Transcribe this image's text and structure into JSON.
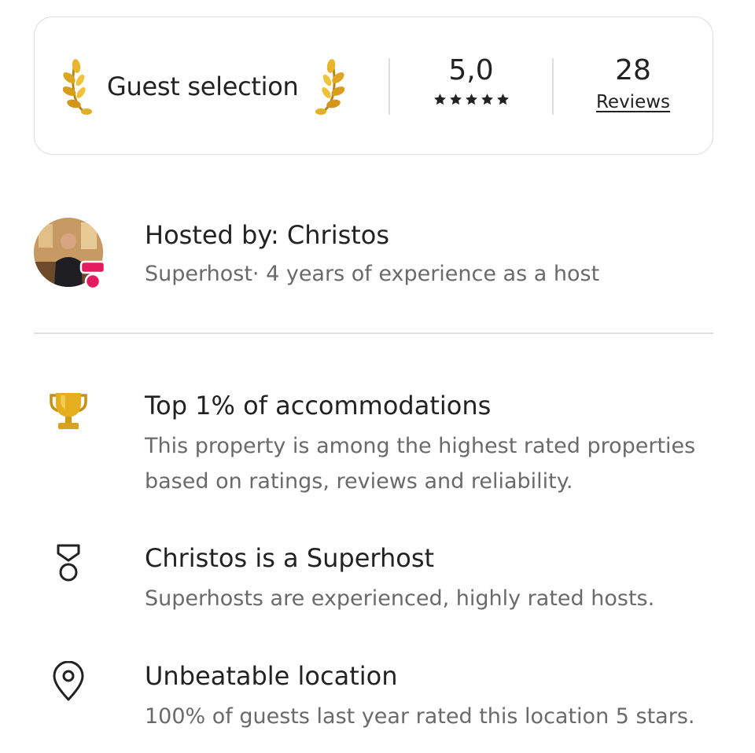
{
  "guest_selection": {
    "badge_label": "Guest selection",
    "rating_value": "5,0",
    "rating_stars": 5,
    "reviews_count": "28",
    "reviews_label": "Reviews",
    "colors": {
      "laurel_gold": "#d9a21c",
      "text": "#222222"
    },
    "icons": [
      "laurel-left-icon",
      "laurel-right-icon",
      "star-icon"
    ]
  },
  "host": {
    "title": "Hosted by: Christos",
    "subtitle": "Superhost· 4 years of experience as a host",
    "badge_color": "#e31c5f",
    "icons": [
      "superhost-badge-icon"
    ]
  },
  "highlights": [
    {
      "icon": "trophy-icon",
      "title": "Top 1% of accommodations",
      "description": "This property is among the highest rated properties based on ratings, reviews and reliability."
    },
    {
      "icon": "medal-icon",
      "title": "Christos is a Superhost",
      "description": "Superhosts are experienced, highly rated hosts."
    },
    {
      "icon": "location-pin-icon",
      "title": "Unbeatable location",
      "description": "100% of guests last year rated this location 5 stars."
    }
  ],
  "colors": {
    "primary_text": "#222222",
    "secondary_text": "#6a6a6a",
    "border": "#dddddd",
    "trophy_gold": "#e0a818"
  }
}
